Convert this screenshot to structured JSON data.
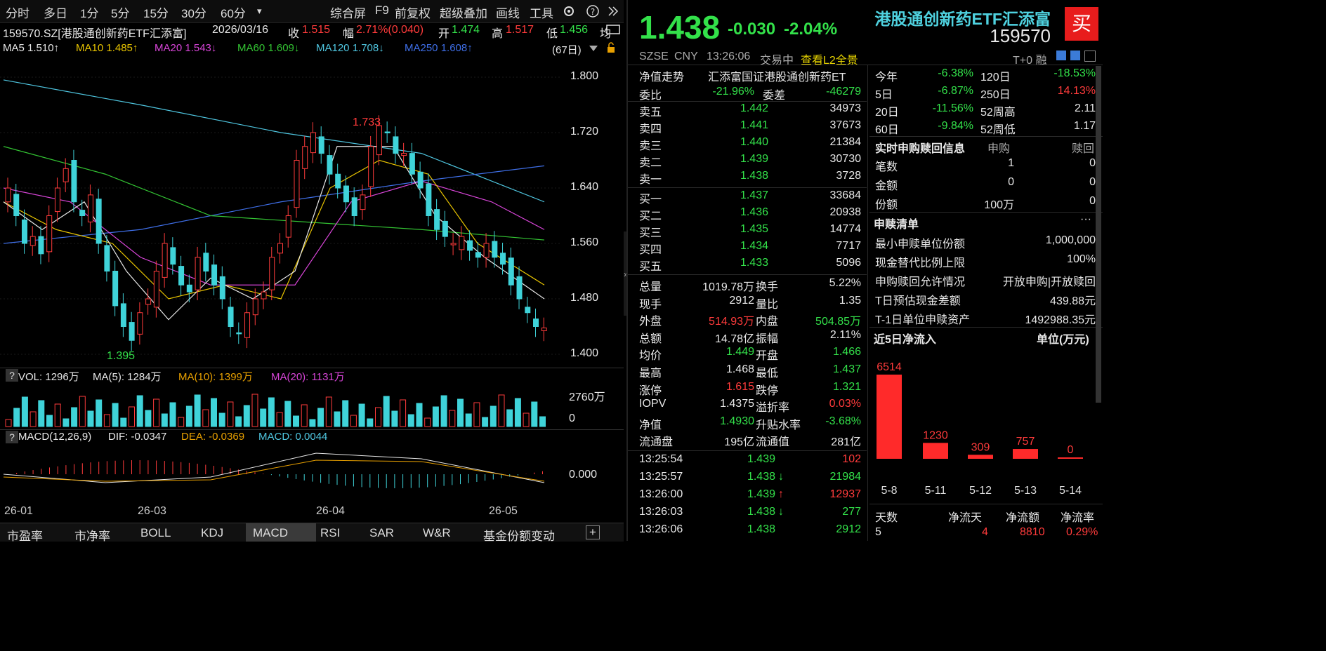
{
  "toolbar": {
    "periods": [
      "分时",
      "多日",
      "1分",
      "5分",
      "15分",
      "30分",
      "60分"
    ],
    "more": "▾",
    "tools": [
      "综合屏",
      "F9",
      "前复权",
      "超级叠加",
      "画线",
      "工具"
    ]
  },
  "info": {
    "code": "159570.SZ[港股通创新药ETF汇添富]",
    "date": "2026/03/16",
    "close_label": "收",
    "close": "1.515",
    "change_label": "幅",
    "change": "2.71%(0.040)",
    "open_label": "开",
    "open": "1.474",
    "high_label": "高",
    "high": "1.517",
    "low_label": "低",
    "low": "1.456",
    "more": "均"
  },
  "ma": {
    "ma5": "MA5 1.510↑",
    "ma10": "MA10 1.485↑",
    "ma20": "MA20 1.543↓",
    "ma60": "MA60 1.609↓",
    "ma120": "MA120 1.708↓",
    "ma250": "MA250 1.608↑",
    "period": "(67日)"
  },
  "price_axis": [
    "1.800",
    "1.720",
    "1.640",
    "1.560",
    "1.480",
    "1.400"
  ],
  "annotations": {
    "high": "1.733",
    "low": "1.395"
  },
  "vol_header": {
    "q": "?",
    "vol": "VOL: 1296万",
    "ma5": "MA(5): 1284万",
    "ma10": "MA(10): 1399万",
    "ma20": "MA(20): 1131万",
    "axis_top": "2760万",
    "axis_zero": "0"
  },
  "macd_header": {
    "q": "?",
    "title": "MACD(12,26,9)",
    "dif": "DIF: -0.0347",
    "dea": "DEA: -0.0369",
    "macd": "MACD: 0.0044",
    "axis_zero": "0.000"
  },
  "dates": [
    "26-01",
    "26-03",
    "26-04",
    "26-05"
  ],
  "bottom_tabs": [
    "市盈率",
    "市净率",
    "BOLL",
    "KDJ",
    "MACD",
    "RSI",
    "SAR",
    "W&R",
    "基金份额变动"
  ],
  "active_tab": "MACD",
  "plus": "+",
  "quote": {
    "price": "1.438",
    "change": "-0.030",
    "pct": "-2.04%",
    "name": "港股通创新药ETF汇添富",
    "code": "159570",
    "buy_btn": "买",
    "exchange": "SZSE",
    "currency": "CNY",
    "time": "13:26:06",
    "status": "交易中",
    "l2": "查看L2全景",
    "t0": "T+0 融"
  },
  "nav_row": {
    "label": "净值走势",
    "value": "汇添富国证港股通创新药ET"
  },
  "weibi": {
    "l1": "委比",
    "v1": "-21.96%",
    "l2": "委差",
    "v2": "-46279"
  },
  "asks": [
    {
      "label": "卖五",
      "price": "1.442",
      "vol": "34973"
    },
    {
      "label": "卖四",
      "price": "1.441",
      "vol": "37673"
    },
    {
      "label": "卖三",
      "price": "1.440",
      "vol": "21384"
    },
    {
      "label": "卖二",
      "price": "1.439",
      "vol": "30730"
    },
    {
      "label": "卖一",
      "price": "1.438",
      "vol": "3728"
    }
  ],
  "bids": [
    {
      "label": "买一",
      "price": "1.437",
      "vol": "33684"
    },
    {
      "label": "买二",
      "price": "1.436",
      "vol": "20938"
    },
    {
      "label": "买三",
      "price": "1.435",
      "vol": "14774"
    },
    {
      "label": "买四",
      "price": "1.434",
      "vol": "7717"
    },
    {
      "label": "买五",
      "price": "1.433",
      "vol": "5096"
    }
  ],
  "stats": [
    {
      "l1": "总量",
      "v1": "1019.78万",
      "c1": "white",
      "l2": "换手",
      "v2": "5.22%",
      "c2": "white"
    },
    {
      "l1": "现手",
      "v1": "2912",
      "c1": "white",
      "l2": "量比",
      "v2": "1.35",
      "c2": "white"
    },
    {
      "l1": "外盘",
      "v1": "514.93万",
      "c1": "red",
      "l2": "内盘",
      "v2": "504.85万",
      "c2": "green"
    },
    {
      "l1": "总额",
      "v1": "14.78亿",
      "c1": "white",
      "l2": "振幅",
      "v2": "2.11%",
      "c2": "white"
    },
    {
      "l1": "均价",
      "v1": "1.449",
      "c1": "green",
      "l2": "开盘",
      "v2": "1.466",
      "c2": "green"
    },
    {
      "l1": "最高",
      "v1": "1.468",
      "c1": "white",
      "l2": "最低",
      "v2": "1.437",
      "c2": "green"
    },
    {
      "l1": "涨停",
      "v1": "1.615",
      "c1": "red",
      "l2": "跌停",
      "v2": "1.321",
      "c2": "green"
    },
    {
      "l1": "IOPV",
      "v1": "1.4375",
      "c1": "white",
      "l2": "溢折率",
      "v2": "0.03%",
      "c2": "red"
    },
    {
      "l1": "净值",
      "v1": "1.4930",
      "c1": "green",
      "l2": "升贴水率",
      "v2": "-3.68%",
      "c2": "green"
    },
    {
      "l1": "流通盘",
      "v1": "195亿",
      "c1": "white",
      "l2": "流通值",
      "v2": "281亿",
      "c2": "white"
    }
  ],
  "ticks": [
    {
      "time": "13:25:54",
      "price": "1.439",
      "arrow": "",
      "vol": "102",
      "vc": "red"
    },
    {
      "time": "13:25:57",
      "price": "1.438",
      "arrow": "↓",
      "vol": "21984",
      "vc": "green"
    },
    {
      "time": "13:26:00",
      "price": "1.439",
      "arrow": "↑",
      "vol": "12937",
      "vc": "red"
    },
    {
      "time": "13:26:03",
      "price": "1.438",
      "arrow": "↓",
      "vol": "277",
      "vc": "green"
    },
    {
      "time": "13:26:06",
      "price": "1.438",
      "arrow": "",
      "vol": "2912",
      "vc": "green"
    }
  ],
  "perf": [
    {
      "l1": "今年",
      "v1": "-6.38%",
      "c1": "green",
      "l2": "120日",
      "v2": "-18.53%",
      "c2": "green"
    },
    {
      "l1": "5日",
      "v1": "-6.87%",
      "c1": "green",
      "l2": "250日",
      "v2": "14.13%",
      "c2": "red"
    },
    {
      "l1": "20日",
      "v1": "-11.56%",
      "c1": "green",
      "l2": "52周高",
      "v2": "2.11",
      "c2": "white"
    },
    {
      "l1": "60日",
      "v1": "-9.84%",
      "c1": "green",
      "l2": "52周低",
      "v2": "1.17",
      "c2": "white"
    }
  ],
  "subscribe": {
    "title": "实时申购赎回信息",
    "h1": "申购",
    "h2": "赎回",
    "rows": [
      {
        "label": "笔数",
        "v1": "1",
        "v2": "0"
      },
      {
        "label": "金额",
        "v1": "0",
        "v2": "0"
      },
      {
        "label": "份额",
        "v1": "100万",
        "v2": "0"
      }
    ]
  },
  "redeem_list": {
    "title": "申赎清单",
    "more": "···",
    "rows": [
      {
        "label": "最小申赎单位份额",
        "value": "1,000,000"
      },
      {
        "label": "现金替代比例上限",
        "value": "100%"
      },
      {
        "label": "申购赎回允许情况",
        "value": "开放申购|开放赎回"
      },
      {
        "label": "T日预估现金差额",
        "value": "439.88元"
      },
      {
        "label": "T-1日单位申赎资产",
        "value": "1492988.35元"
      }
    ]
  },
  "inflow": {
    "title": "近5日净流入",
    "unit": "单位(万元)",
    "footer": {
      "h0": "天数",
      "h1": "净流天",
      "h2": "净流额",
      "h3": "净流率",
      "v0": "5",
      "v1": "4",
      "v2": "8810",
      "v3": "0.29%"
    }
  },
  "chart_data": {
    "type": "bar",
    "title": "近5日净流入",
    "ylabel": "单位(万元)",
    "categories": [
      "5-8",
      "5-11",
      "5-12",
      "5-13",
      "5-14"
    ],
    "values": [
      6514,
      1230,
      309,
      757,
      0
    ],
    "value_labels": [
      "6514",
      "1230",
      "309",
      "757",
      "0"
    ],
    "ylim": [
      0,
      6514
    ]
  },
  "colors": {
    "up": "#ff3b3b",
    "down": "#33e14a",
    "candle_down": "#3fd3d9",
    "ma5": "#e8e8e8",
    "ma10": "#e8c400",
    "ma20": "#d845d8",
    "ma60": "#33c433",
    "ma120": "#4fc6e0",
    "ma250": "#3f6fe8"
  }
}
